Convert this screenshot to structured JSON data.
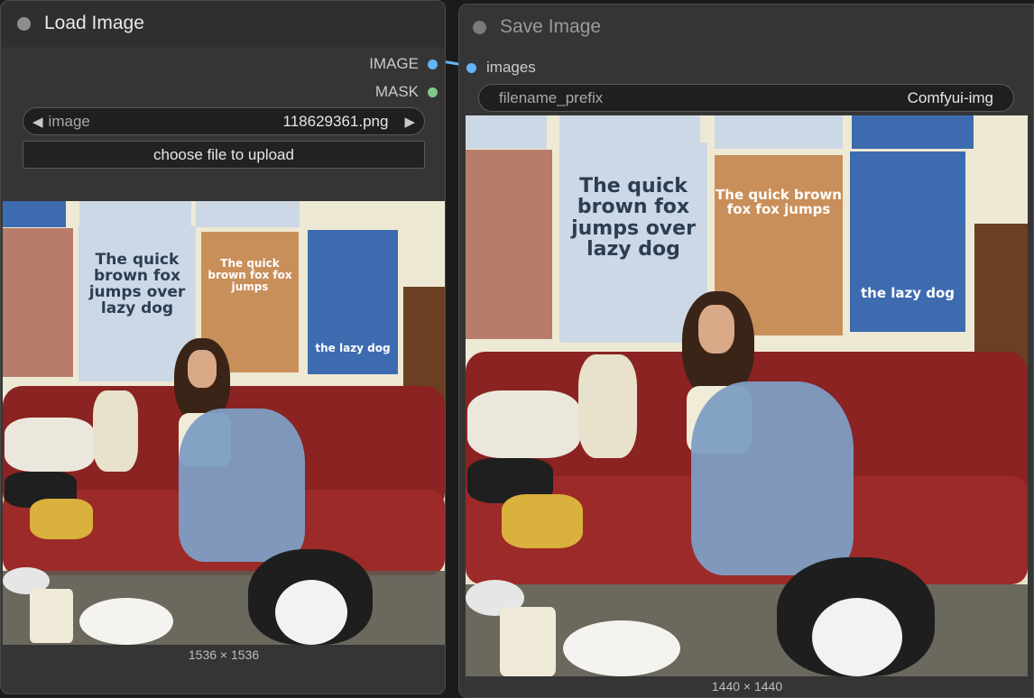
{
  "load_node": {
    "title": "Load Image",
    "outputs": [
      {
        "label": "IMAGE",
        "color": "#64b5f6"
      },
      {
        "label": "MASK",
        "color": "#81c784"
      }
    ],
    "image_widget": {
      "label": "image",
      "value": "118629361.png"
    },
    "upload_button": "choose file to upload",
    "preview_dims": "1536 × 1536",
    "poster_texts": [
      "The quick brown fox jumps over lazy dog",
      "The quick brown fox fox jumps",
      "the lazy dog"
    ]
  },
  "save_node": {
    "title": "Save Image",
    "input": {
      "label": "images",
      "color": "#64b5f6"
    },
    "prefix_widget": {
      "label": "filename_prefix",
      "value": "Comfyui-img"
    },
    "preview_dims": "1440 × 1440",
    "poster_texts": [
      "The quick brown fox jumps over lazy dog",
      "The quick brown fox fox jumps",
      "the lazy dog"
    ]
  },
  "colors": {
    "node_bg": "#353535",
    "canvas_bg": "#1b1b1b",
    "link": "#64b5f6"
  }
}
